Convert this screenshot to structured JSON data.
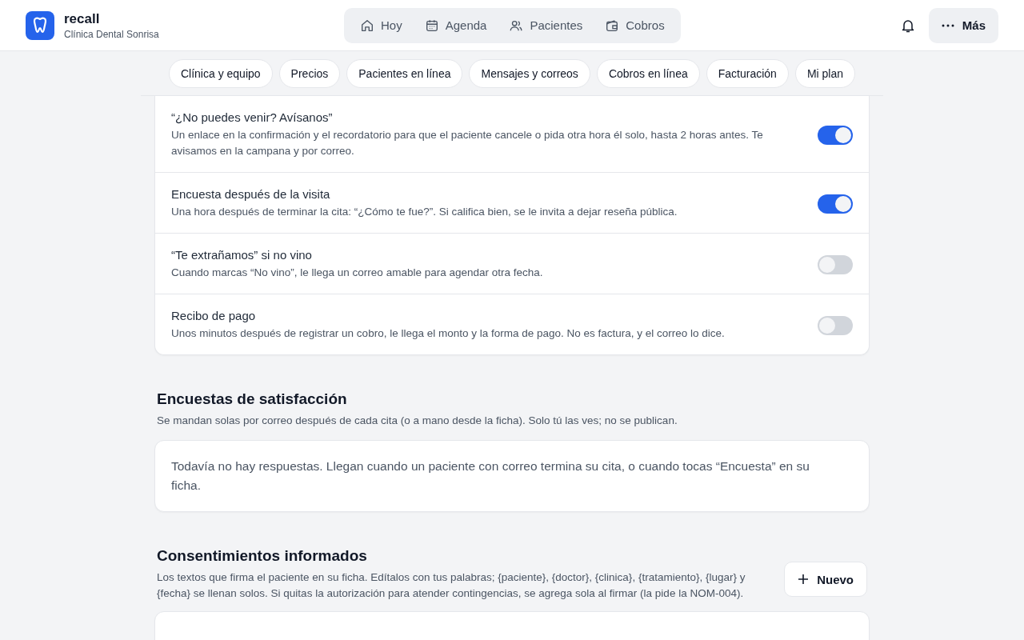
{
  "brand": {
    "name": "recall",
    "clinic": "Clínica Dental Sonrisa"
  },
  "nav": [
    {
      "label": "Hoy",
      "kind": "home",
      "selected": false
    },
    {
      "label": "Agenda",
      "kind": "calendar",
      "selected": false
    },
    {
      "label": "Pacientes",
      "kind": "users",
      "selected": false
    },
    {
      "label": "Cobros",
      "kind": "wallet",
      "selected": false
    }
  ],
  "more_button": {
    "label": "Más"
  },
  "settings_tabs": [
    {
      "label": "Clínica y equipo",
      "selected": false
    },
    {
      "label": "Precios",
      "selected": false
    },
    {
      "label": "Pacientes en línea",
      "selected": false
    },
    {
      "label": "Mensajes y correos",
      "selected": false
    },
    {
      "label": "Cobros en línea",
      "selected": false
    },
    {
      "label": "Facturación",
      "selected": false
    },
    {
      "label": "Mi plan",
      "selected": false
    }
  ],
  "automations": [
    {
      "title": "“¿No puedes venir? Avísanos”",
      "description": "Un enlace en la confirmación y el recordatorio para que el paciente cancele o pida otra hora él solo, hasta 2 horas antes. Te avisamos en la campana y por correo.",
      "on": true
    },
    {
      "title": "Encuesta después de la visita",
      "description": "Una hora después de terminar la cita: “¿Cómo te fue?”. Si califica bien, se le invita a dejar reseña pública.",
      "on": true
    },
    {
      "title": "“Te extrañamos” si no vino",
      "description": "Cuando marcas “No vino”, le llega un correo amable para agendar otra fecha.",
      "on": false
    },
    {
      "title": "Recibo de pago",
      "description": "Unos minutos después de registrar un cobro, le llega el monto y la forma de pago. No es factura, y el correo lo dice.",
      "on": false
    }
  ],
  "surveys": {
    "title": "Encuestas de satisfacción",
    "subtitle": "Se mandan solas por correo después de cada cita (o a mano desde la ficha). Solo tú las ves; no se publican.",
    "empty_message": "Todavía no hay respuestas. Llegan cuando un paciente con correo termina su cita, o cuando tocas “Encuesta” en su ficha."
  },
  "consents": {
    "title": "Consentimientos informados",
    "subtitle": "Los textos que firma el paciente en su ficha. Edítalos con tus palabras; {paciente}, {doctor}, {clinica}, {tratamiento}, {lugar} y {fecha} se llenan solos. Si quitas la autorización para atender contingencias, se agrega sola al firmar (la pide la NOM-004).",
    "new_button": "Nuevo"
  }
}
